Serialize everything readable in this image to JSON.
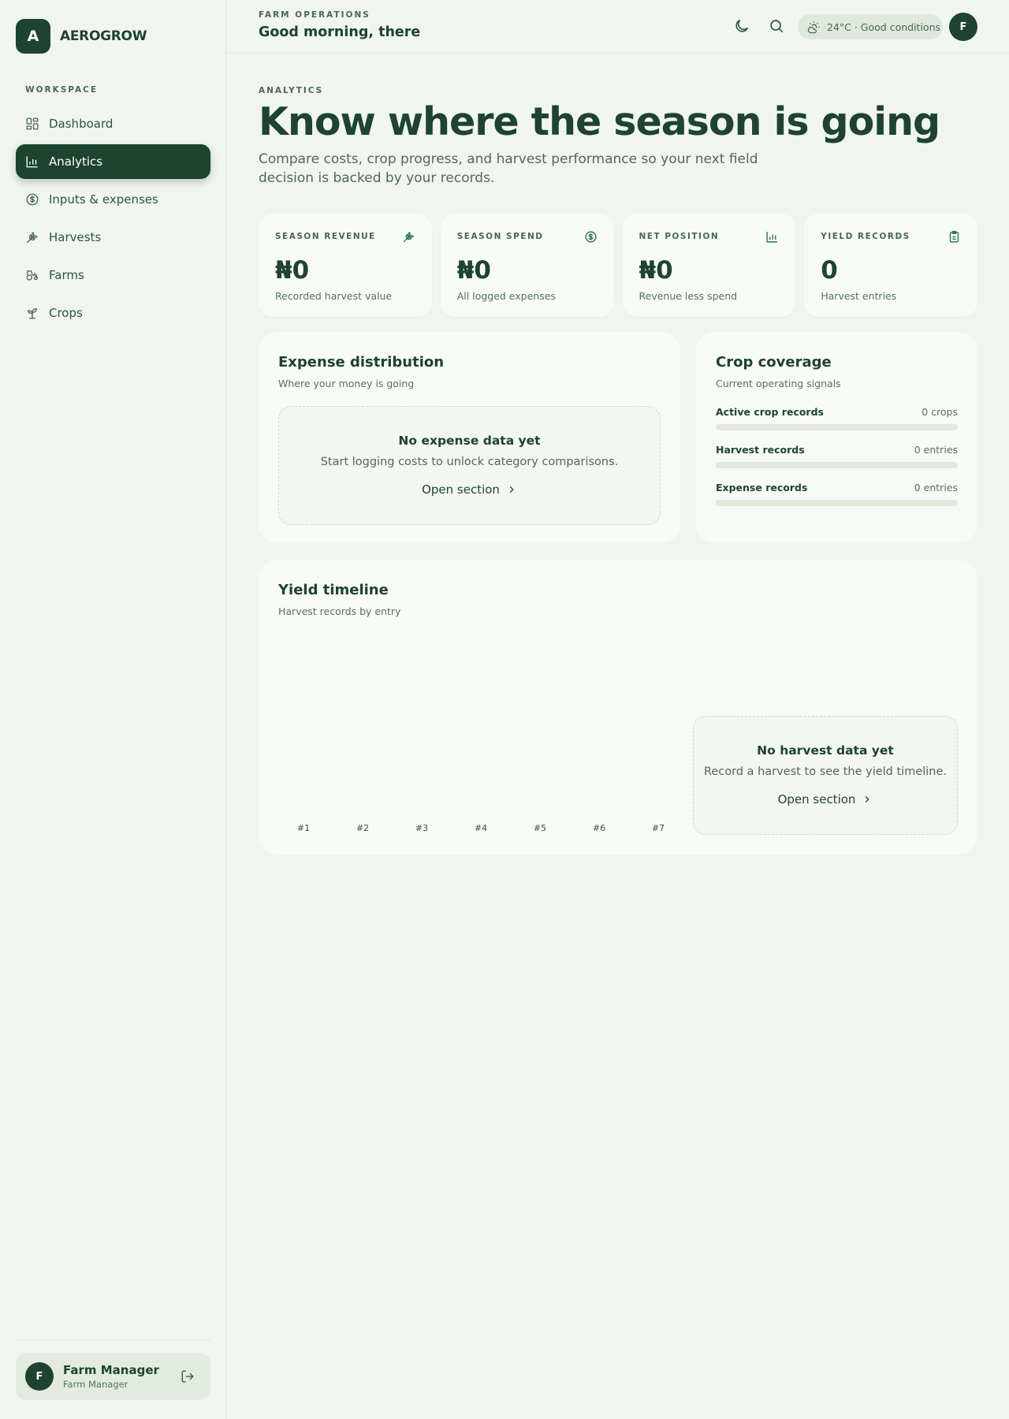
{
  "app": {
    "logo_letter": "A",
    "name": "AEROGROW"
  },
  "sidebar": {
    "section_label": "WORKSPACE",
    "items": [
      {
        "label": "Dashboard",
        "icon": "grid-icon",
        "active": false
      },
      {
        "label": "Analytics",
        "icon": "bar-chart-icon",
        "active": true
      },
      {
        "label": "Inputs & expenses",
        "icon": "dollar-circle-icon",
        "active": false
      },
      {
        "label": "Harvests",
        "icon": "wheat-icon",
        "active": false
      },
      {
        "label": "Farms",
        "icon": "tractor-icon",
        "active": false
      },
      {
        "label": "Crops",
        "icon": "sprout-icon",
        "active": false
      }
    ],
    "user": {
      "initial": "F",
      "name": "Farm Manager",
      "role": "Farm Manager"
    }
  },
  "header": {
    "eyebrow": "FARM OPERATIONS",
    "greeting": "Good morning, there",
    "weather": "24°C · Good conditions",
    "avatar_initial": "F"
  },
  "page": {
    "eyebrow": "ANALYTICS",
    "title": "Know where the season is going",
    "description": "Compare costs, crop progress, and harvest performance so your next field decision is backed by your records."
  },
  "stats": [
    {
      "label": "SEASON REVENUE",
      "value": "₦0",
      "sub": "Recorded harvest value",
      "icon": "wheat-icon"
    },
    {
      "label": "SEASON SPEND",
      "value": "₦0",
      "sub": "All logged expenses",
      "icon": "dollar-circle-icon"
    },
    {
      "label": "NET POSITION",
      "value": "₦0",
      "sub": "Revenue less spend",
      "icon": "bar-chart-icon"
    },
    {
      "label": "YIELD RECORDS",
      "value": "0",
      "sub": "Harvest entries",
      "icon": "clipboard-icon"
    }
  ],
  "expense": {
    "title": "Expense distribution",
    "subtitle": "Where your money is going",
    "empty_title": "No expense data yet",
    "empty_desc": "Start logging costs to unlock category comparisons.",
    "link": "Open section"
  },
  "coverage": {
    "title": "Crop coverage",
    "subtitle": "Current operating signals",
    "rows": [
      {
        "label": "Active crop records",
        "value": "0 crops",
        "fraction": 0
      },
      {
        "label": "Harvest records",
        "value": "0 entries",
        "fraction": 0
      },
      {
        "label": "Expense records",
        "value": "0 entries",
        "fraction": 0
      }
    ]
  },
  "timeline": {
    "title": "Yield timeline",
    "subtitle": "Harvest records by entry",
    "empty_title": "No harvest data yet",
    "empty_desc": "Record a harvest to see the yield timeline.",
    "link": "Open section"
  },
  "chart_data": {
    "type": "bar",
    "categories": [
      "#1",
      "#2",
      "#3",
      "#4",
      "#5",
      "#6",
      "#7"
    ],
    "values": [
      0,
      0,
      0,
      0,
      0,
      0,
      0
    ]
  },
  "colors": {
    "brand": "#1e4330",
    "accent": "#2e7a4a",
    "background": "#f0f5ef",
    "card": "#f8faf7"
  }
}
